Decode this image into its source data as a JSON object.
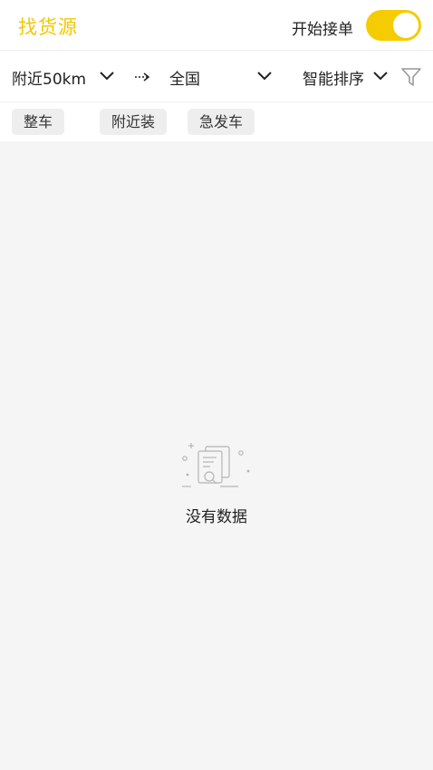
{
  "header": {
    "title": "找货源",
    "accept_orders_label": "开始接单",
    "accept_orders_on": true
  },
  "filters": {
    "origin": "附近50km",
    "destination": "全国",
    "sort": "智能排序"
  },
  "tags": [
    "整车",
    "附近装",
    "急发车"
  ],
  "empty_state": {
    "text": "没有数据"
  },
  "colors": {
    "brand": "#f2c800",
    "toggle_on": "#f5cc00",
    "background": "#f5f5f5"
  }
}
